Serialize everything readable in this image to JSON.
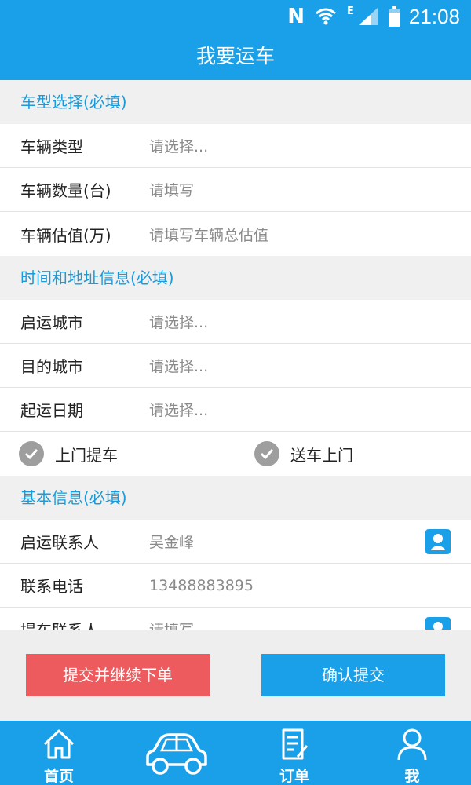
{
  "status_bar": {
    "n_label": "N",
    "network_type": "E",
    "time": "21:08"
  },
  "title": "我要运车",
  "sections": {
    "vehicle": {
      "header": "车型选择(必填)",
      "rows": [
        {
          "label": "车辆类型",
          "value": "请选择..."
        },
        {
          "label": "车辆数量(台)",
          "value": "请填写"
        },
        {
          "label": "车辆估值(万)",
          "value": "请填写车辆总估值"
        }
      ]
    },
    "time_address": {
      "header": "时间和地址信息(必填)",
      "rows": [
        {
          "label": "启运城市",
          "value": "请选择..."
        },
        {
          "label": "目的城市",
          "value": "请选择..."
        },
        {
          "label": "起运日期",
          "value": "请选择..."
        }
      ],
      "options": [
        {
          "label": "上门提车"
        },
        {
          "label": "送车上门"
        }
      ]
    },
    "basic": {
      "header": "基本信息(必填)",
      "rows": [
        {
          "label": "启运联系人",
          "value": "吴金峰"
        },
        {
          "label": "联系电话",
          "value": "13488883895"
        },
        {
          "label": "提车联系人",
          "value": "请填写"
        }
      ]
    }
  },
  "buttons": {
    "submit_continue": "提交并继续下单",
    "confirm_submit": "确认提交"
  },
  "tabs": [
    {
      "label": "首页",
      "icon": "home-icon"
    },
    {
      "label": "",
      "icon": "car-icon"
    },
    {
      "label": "订单",
      "icon": "order-icon"
    },
    {
      "label": "我",
      "icon": "user-icon"
    }
  ],
  "colors": {
    "primary": "#1aa0e8",
    "danger": "#ed5b5e",
    "section_text": "#1a9ad9"
  }
}
